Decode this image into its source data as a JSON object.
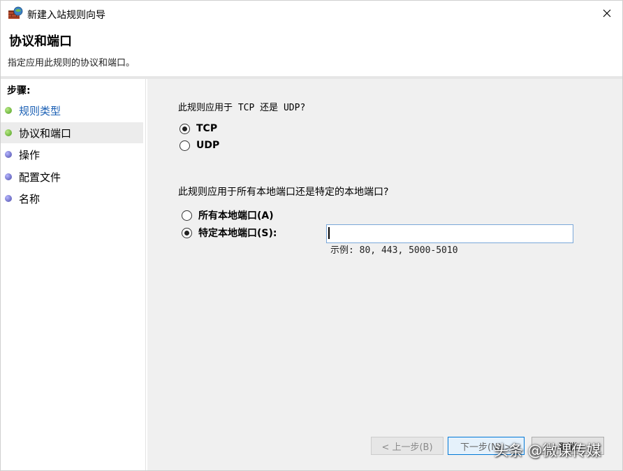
{
  "window": {
    "title": "新建入站规则向导",
    "close_icon": "close-icon",
    "app_icon": "firewall-icon"
  },
  "header": {
    "title": "协议和端口",
    "description": "指定应用此规则的协议和端口。"
  },
  "steps": {
    "title": "步骤:",
    "items": [
      {
        "label": "规则类型",
        "status": "done",
        "color": "#4e9e1e"
      },
      {
        "label": "协议和端口",
        "status": "current",
        "color": "#4e9e1e"
      },
      {
        "label": "操作",
        "status": "pending",
        "color": "#4a4aa8"
      },
      {
        "label": "配置文件",
        "status": "pending",
        "color": "#4a4aa8"
      },
      {
        "label": "名称",
        "status": "pending",
        "color": "#4a4aa8"
      }
    ]
  },
  "main": {
    "protocol_question": "此规则应用于 TCP 还是 UDP?",
    "protocol_options": [
      {
        "label": "TCP",
        "checked": true
      },
      {
        "label": "UDP",
        "checked": false
      }
    ],
    "port_question": "此规则应用于所有本地端口还是特定的本地端口?",
    "port_options": [
      {
        "label": "所有本地端口(A)",
        "checked": false
      },
      {
        "label": "特定本地端口(S):",
        "checked": true
      }
    ],
    "port_input_value": "",
    "port_example": "示例: 80, 443, 5000-5010"
  },
  "buttons": {
    "back": "< 上一步(B)",
    "next": "下一步(N) >",
    "cancel": "取消"
  },
  "watermark": "头条 @微课传媒",
  "colors": {
    "accent": "#0078d7",
    "link": "#1a5fb4",
    "content_bg": "#f0f0f0"
  }
}
